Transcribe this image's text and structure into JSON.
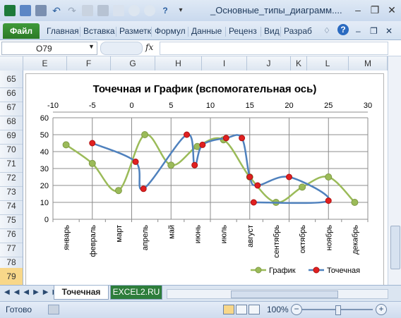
{
  "window": {
    "title": "_Основные_типы_диаграмм....",
    "minimize": "–",
    "maximize": "❐",
    "close": "✕"
  },
  "ribbon": {
    "file_tab": "Файл",
    "tabs": [
      "Главная",
      "Вставка",
      "Разметк",
      "Формул",
      "Данные",
      "Реценз",
      "Вид",
      "Разраб"
    ]
  },
  "formula_bar": {
    "name_box": "O79",
    "fx": "fx",
    "formula": ""
  },
  "columns": [
    "E",
    "F",
    "G",
    "H",
    "I",
    "J",
    "K",
    "L",
    "M"
  ],
  "rows": [
    "65",
    "66",
    "67",
    "68",
    "69",
    "70",
    "71",
    "72",
    "73",
    "74",
    "75",
    "76",
    "77",
    "78",
    "79"
  ],
  "active_row": "79",
  "chart_data": {
    "type": "line",
    "title": "Точечная и График (вспомогательная ось)",
    "categories": [
      "январь",
      "февраль",
      "март",
      "апрель",
      "май",
      "июнь",
      "июль",
      "август",
      "сентябрь",
      "октябрь",
      "ноябрь",
      "декабрь"
    ],
    "ylim": [
      0,
      60
    ],
    "yticks": [
      0,
      10,
      20,
      30,
      40,
      50,
      60
    ],
    "x2lim": [
      -10,
      30
    ],
    "x2ticks": [
      -10,
      -5,
      0,
      5,
      10,
      15,
      20,
      25,
      30
    ],
    "series": [
      {
        "name": "График",
        "type": "line",
        "color": "#9bbb59",
        "values": [
          44,
          33,
          17,
          50,
          32,
          43,
          47,
          25,
          10,
          19,
          25,
          10
        ]
      },
      {
        "name": "Точечная",
        "type": "scatter",
        "color": "#4f81bd",
        "marker_color": "#e02020",
        "points": [
          [
            -5,
            45
          ],
          [
            0.5,
            34
          ],
          [
            1.5,
            18
          ],
          [
            7,
            50
          ],
          [
            8,
            32
          ],
          [
            9,
            44
          ],
          [
            12,
            48
          ],
          [
            14,
            48
          ],
          [
            15,
            25
          ],
          [
            16,
            20
          ],
          [
            20,
            25
          ],
          [
            25,
            11
          ],
          [
            15.5,
            10
          ]
        ]
      }
    ],
    "legend": "bottom-right"
  },
  "sheets": {
    "active": "Точечная",
    "other": "EXCEL2.RU"
  },
  "status": {
    "ready": "Готово",
    "zoom": "100%",
    "zoom_level": 0.5
  }
}
